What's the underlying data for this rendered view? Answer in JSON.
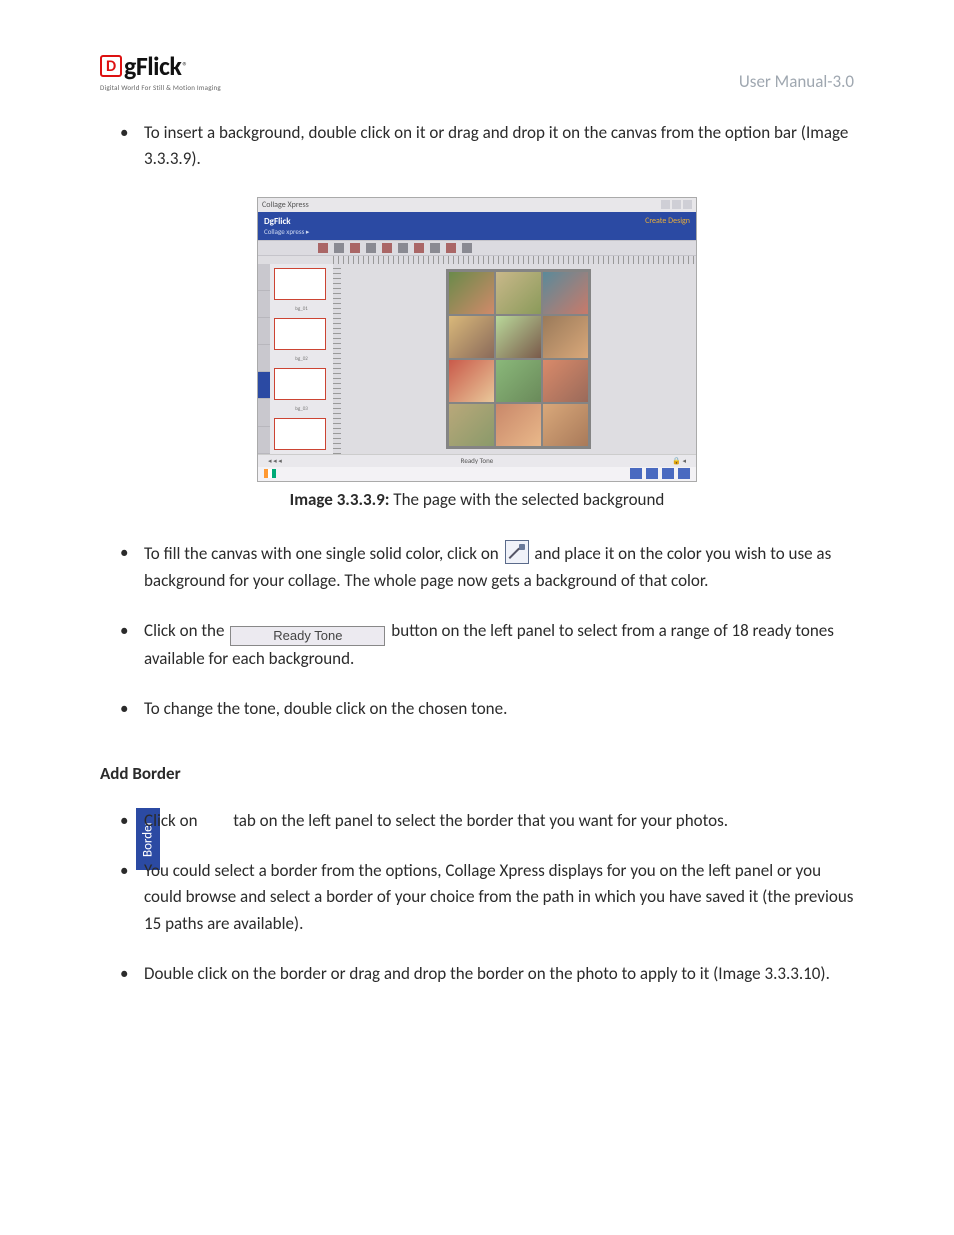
{
  "header": {
    "title": "User Manual-3.0"
  },
  "logo": {
    "mark": "D",
    "text": "gFlick",
    "reg": "®",
    "sub": "Digital World For Still & Motion Imaging"
  },
  "b1": {
    "text": "To insert a background, double click on it or drag and drop it on the canvas from the option bar (Image 3.3.3.9)."
  },
  "fig": {
    "caption_label": "Image 3.3.3.9:",
    "caption_text": " The page with the selected background",
    "titlebar": "Collage Xpress",
    "brand": "DgFlick",
    "crumb": "Collage xpress ▸",
    "right_top": "Create Design",
    "ready_label": "Ready Tone"
  },
  "b2": {
    "pre": "To fill the canvas with one single solid color, click on ",
    "post": " and place it on the color you wish to use as background for your collage. The whole page now gets a background of that color."
  },
  "b3": {
    "pre": "Click on the ",
    "btn": "Ready Tone",
    "post": " button on the left panel to select from a range of 18 ready tones available for each background."
  },
  "b4": {
    "text": "To change the tone, double click on the chosen tone."
  },
  "section": {
    "title": "Add Border"
  },
  "b5": {
    "pre": "Click on ",
    "tab_label": "Border",
    "post": " tab on the left panel to select the border that you want for your photos."
  },
  "b6": {
    "text": "You could select a border from the options, Collage Xpress displays for you on the left panel or you could browse and select a border of your choice from the path in which you have saved it (the previous 15 paths are available)."
  },
  "b7": {
    "text": "Double click on the border or drag and drop the border on the photo to apply to it (Image 3.3.3.10)."
  }
}
